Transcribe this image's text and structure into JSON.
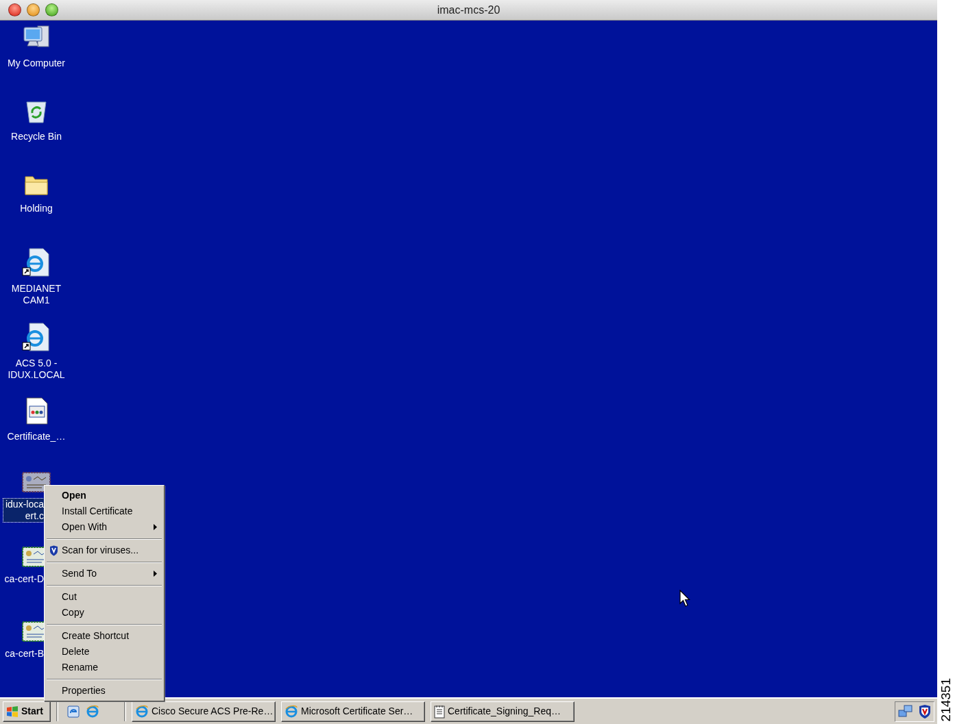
{
  "window": {
    "title": "imac-mcs-20"
  },
  "desktop_icons": [
    {
      "kind": "computer",
      "lines": [
        "My Computer"
      ],
      "selected": false,
      "covered_by_menu": false
    },
    {
      "kind": "recycle-bin",
      "lines": [
        "Recycle Bin"
      ],
      "selected": false,
      "covered_by_menu": false
    },
    {
      "kind": "folder",
      "lines": [
        "Holding"
      ],
      "selected": false,
      "covered_by_menu": false
    },
    {
      "kind": "web-shortcut",
      "lines": [
        "MEDIANET",
        "CAM1"
      ],
      "selected": false,
      "covered_by_menu": false
    },
    {
      "kind": "web-shortcut",
      "lines": [
        "ACS 5.0 -",
        "IDUX.LOCAL"
      ],
      "selected": false,
      "covered_by_menu": false
    },
    {
      "kind": "document",
      "lines": [
        "Certificate_…"
      ],
      "selected": false,
      "covered_by_menu": false
    },
    {
      "kind": "certificate",
      "lines": [
        "idux-loca",
        "ert.c"
      ],
      "selected": true,
      "covered_by_menu": true
    },
    {
      "kind": "certificate",
      "lines": [
        "ca-cert-D"
      ],
      "selected": false,
      "covered_by_menu": true
    },
    {
      "kind": "certificate",
      "lines": [
        "ca-cert-B"
      ],
      "selected": false,
      "covered_by_menu": true
    }
  ],
  "context_menu": {
    "items": [
      {
        "kind": "item",
        "label": "Open",
        "default": true,
        "submenu": false
      },
      {
        "kind": "item",
        "label": "Install Certificate",
        "default": false,
        "submenu": false
      },
      {
        "kind": "item",
        "label": "Open With",
        "default": false,
        "submenu": true
      },
      {
        "kind": "separator"
      },
      {
        "kind": "shield-item",
        "label": "Scan for viruses...",
        "default": false,
        "submenu": false
      },
      {
        "kind": "separator"
      },
      {
        "kind": "item",
        "label": "Send To",
        "default": false,
        "submenu": true
      },
      {
        "kind": "separator"
      },
      {
        "kind": "item",
        "label": "Cut",
        "default": false,
        "submenu": false
      },
      {
        "kind": "item",
        "label": "Copy",
        "default": false,
        "submenu": false
      },
      {
        "kind": "separator"
      },
      {
        "kind": "item",
        "label": "Create Shortcut",
        "default": false,
        "submenu": false
      },
      {
        "kind": "item",
        "label": "Delete",
        "default": false,
        "submenu": false
      },
      {
        "kind": "item",
        "label": "Rename",
        "default": false,
        "submenu": false
      },
      {
        "kind": "separator"
      },
      {
        "kind": "item",
        "label": "Properties",
        "default": false,
        "submenu": false
      }
    ]
  },
  "taskbar": {
    "start_label": "Start",
    "quick_launch": [
      {
        "kind": "desktop"
      },
      {
        "kind": "browser"
      }
    ],
    "tasks": [
      {
        "kind": "browser",
        "label": "Cisco Secure ACS Pre-Re…",
        "selected": false
      },
      {
        "kind": "browser",
        "label": "Microsoft Certificate Ser…",
        "selected": false
      },
      {
        "kind": "notepad",
        "label": "Certificate_Signing_Req…",
        "selected": false
      }
    ],
    "tray": [
      {
        "kind": "network"
      },
      {
        "kind": "shield"
      }
    ]
  },
  "figure_id": "214351"
}
